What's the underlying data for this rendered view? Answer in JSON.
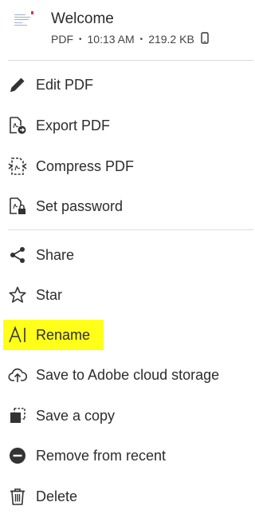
{
  "file": {
    "name": "Welcome",
    "type": "PDF",
    "time": "10:13 AM",
    "size": "219.2 KB",
    "location_icon": "phone-icon"
  },
  "menu": {
    "edit_pdf": "Edit PDF",
    "export_pdf": "Export PDF",
    "compress_pdf": "Compress PDF",
    "set_password": "Set password",
    "share": "Share",
    "star": "Star",
    "rename": "Rename",
    "save_cloud": "Save to Adobe cloud storage",
    "save_copy": "Save a copy",
    "remove_recent": "Remove from recent",
    "delete": "Delete"
  },
  "colors": {
    "highlight": "#ffff1a",
    "text": "#2c2c2c"
  }
}
